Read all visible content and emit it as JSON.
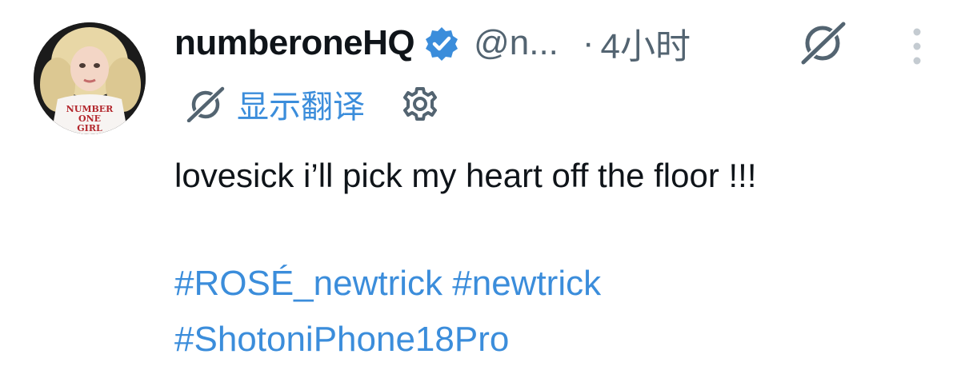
{
  "tweet": {
    "author_name": "numberoneHQ",
    "handle": "@n...",
    "separator": "·",
    "time": "4小时",
    "translate_label": "显示翻译",
    "body": "lovesick i’ll pick my heart off the floor !!!",
    "hashtags": [
      "#ROSÉ_newtrick",
      "#newtrick",
      "#ShotoniPhone18Pro"
    ],
    "avatar_shirt_text": [
      "NUMBER",
      "ONE",
      "GIRL"
    ]
  },
  "colors": {
    "link": "#3b8ddb",
    "muted": "#536471",
    "verified": "#3b8ddb",
    "text": "#0f1419"
  },
  "icons": [
    "verified-badge-icon",
    "grok-icon",
    "more-icon",
    "translate-icon",
    "gear-icon"
  ]
}
